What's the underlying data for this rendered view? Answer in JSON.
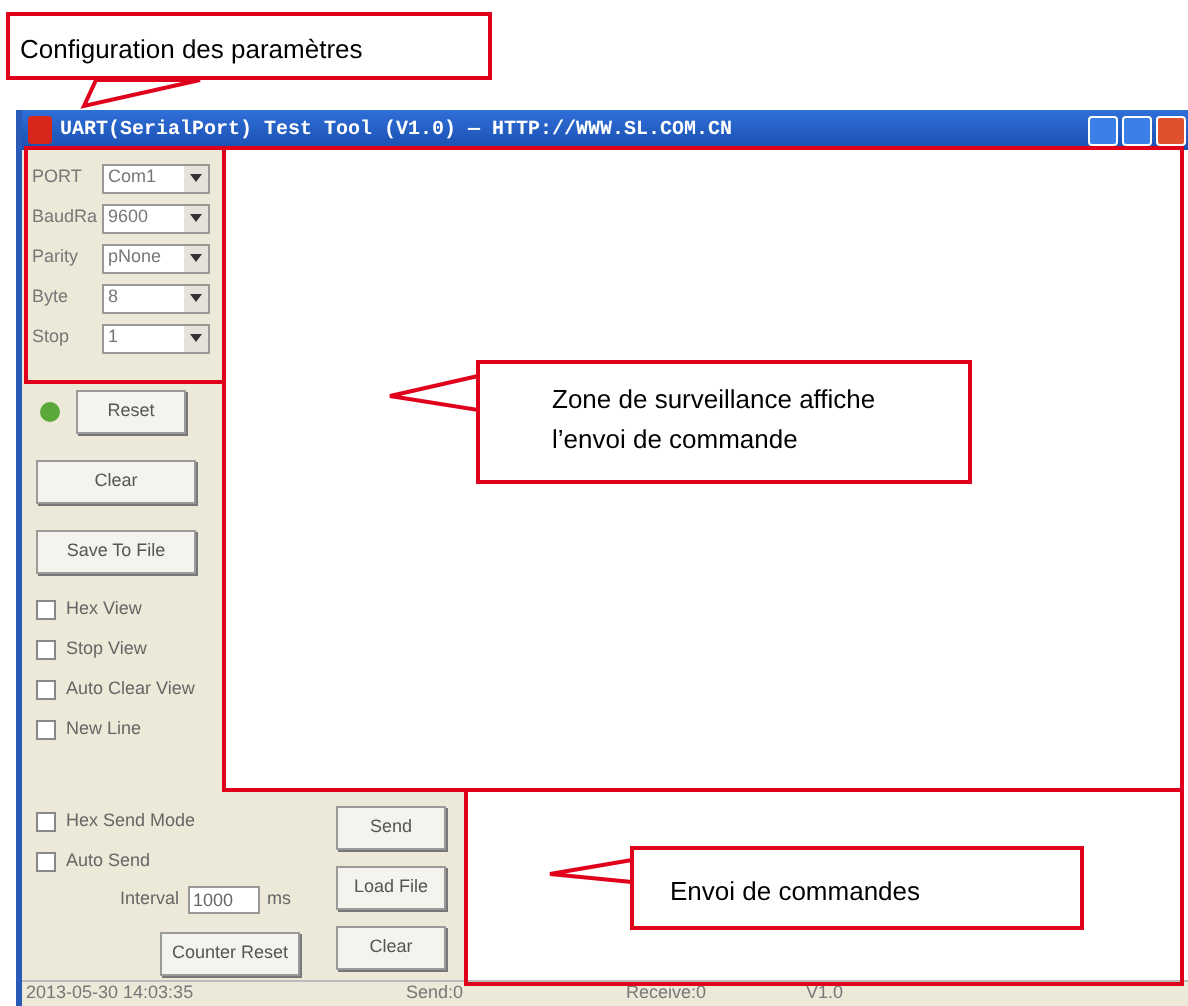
{
  "annotations": {
    "config": "Configuration des paramètres",
    "monitor": "Zone de surveillance affiche l’envoi de commande",
    "send": "Envoi de commandes"
  },
  "window": {
    "title": "UART(SerialPort) Test Tool (V1.0) — HTTP://WWW.SL.COM.CN"
  },
  "settings": [
    {
      "label": "PORT",
      "value": "Com1"
    },
    {
      "label": "BaudRa",
      "value": "9600"
    },
    {
      "label": "Parity",
      "value": "pNone"
    },
    {
      "label": "Byte",
      "value": "8"
    },
    {
      "label": "Stop",
      "value": "1"
    }
  ],
  "indicator": {
    "on": true
  },
  "reset_button": "Reset",
  "view_buttons": [
    "Clear",
    "Save To File"
  ],
  "view_options": [
    {
      "label": "Hex View",
      "checked": false
    },
    {
      "label": "Stop View",
      "checked": false
    },
    {
      "label": "Auto Clear View",
      "checked": false
    },
    {
      "label": "New Line",
      "checked": false
    }
  ],
  "send_options": [
    {
      "label": "Hex Send Mode",
      "checked": false
    },
    {
      "label": "Auto Send",
      "checked": false
    }
  ],
  "interval": {
    "label": "Interval",
    "value": "1000",
    "unit": "ms"
  },
  "counter_reset": "Counter Reset",
  "send_buttons": [
    "Send",
    "Load File",
    "Clear"
  ],
  "status_bar": [
    "2013-05-30 14:03:35",
    "Send:0",
    "Receive:0",
    "V1.0"
  ]
}
